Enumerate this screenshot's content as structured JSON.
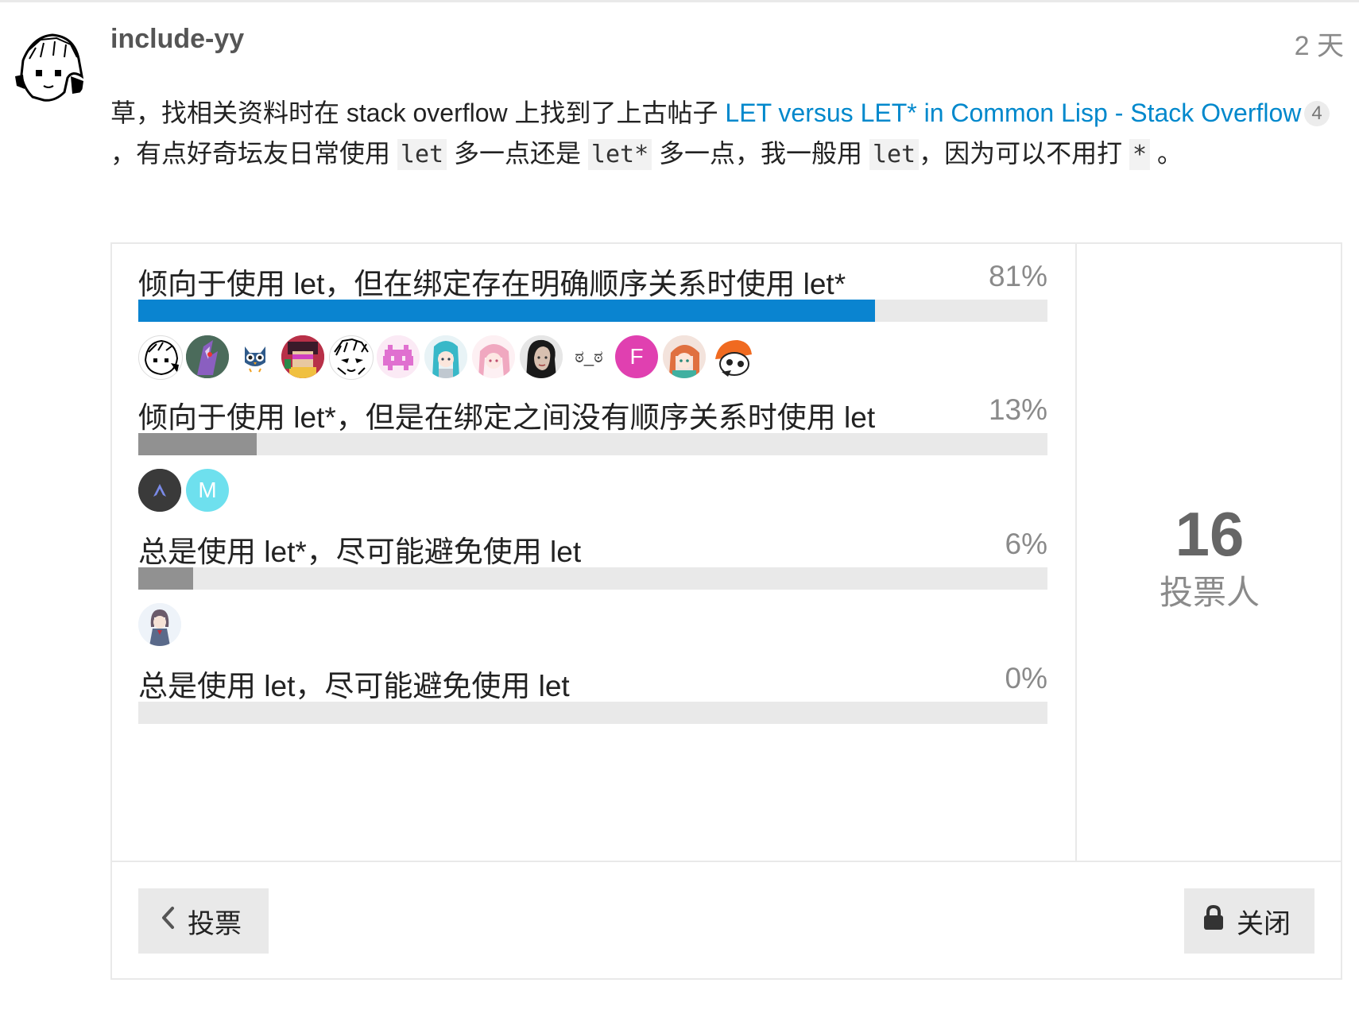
{
  "post": {
    "username": "include-yy",
    "date": "2 天",
    "body_1": "草，找相关资料时在 stack overflow 上找到了上古帖子 ",
    "link_text": "LET versus LET* in Common Lisp - Stack Overflow",
    "link_clicks": "4",
    "body_2": "，有点好奇坛友日常使用 ",
    "code_let_1": "let",
    "body_3": " 多一点还是 ",
    "code_let_star_1": "let*",
    "body_4": " 多一点，我一般用 ",
    "code_let_2": "let",
    "body_5": "，因为可以不用打 ",
    "code_star": "*",
    "body_6": " 。"
  },
  "poll": {
    "options": [
      {
        "label": "倾向于使用 let，但在绑定存在明确顺序关系时使用 let*",
        "percent_text": "81%",
        "percent": 81,
        "leading": true,
        "voter_avatars": 13
      },
      {
        "label": "倾向于使用 let*，但是在绑定之间没有顺序关系时使用 let",
        "percent_text": "13%",
        "percent": 13,
        "leading": false,
        "voter_avatars": 2
      },
      {
        "label": "总是使用 let*，尽可能避免使用 let",
        "percent_text": "6%",
        "percent": 6,
        "leading": false,
        "voter_avatars": 1
      },
      {
        "label": "总是使用 let，尽可能避免使用 let",
        "percent_text": "0%",
        "percent": 0,
        "leading": false,
        "voter_avatars": 0
      }
    ],
    "option1_voters": [
      "sketch-avatar",
      "dragon-avatar",
      "owl-avatar",
      "pixel-art-avatar",
      "manga-avatar",
      "pink-invader-avatar",
      "miku-avatar",
      "pink-hair-avatar",
      "portrait-avatar",
      "emoticon-avatar",
      "F",
      "redhead-avatar",
      "orange-cap-avatar"
    ],
    "option1_emoticon": "ಠ_ಠ",
    "option1_letter": "F",
    "option2_voters": [
      "arch-avatar",
      "M"
    ],
    "option2_letter": "M",
    "option3_voters": [
      "schoolgirl-avatar"
    ],
    "voter_count": "16",
    "voter_label": "投票人",
    "vote_button_label": "投票",
    "close_button_label": "关闭"
  },
  "colors": {
    "link": "#0088cc",
    "leading_bar": "#0a84d0",
    "other_bar": "#919191",
    "avatar_f": "#e040b0",
    "avatar_m": "#6ee0ee",
    "avatar_arch": "#3a3a3a"
  }
}
